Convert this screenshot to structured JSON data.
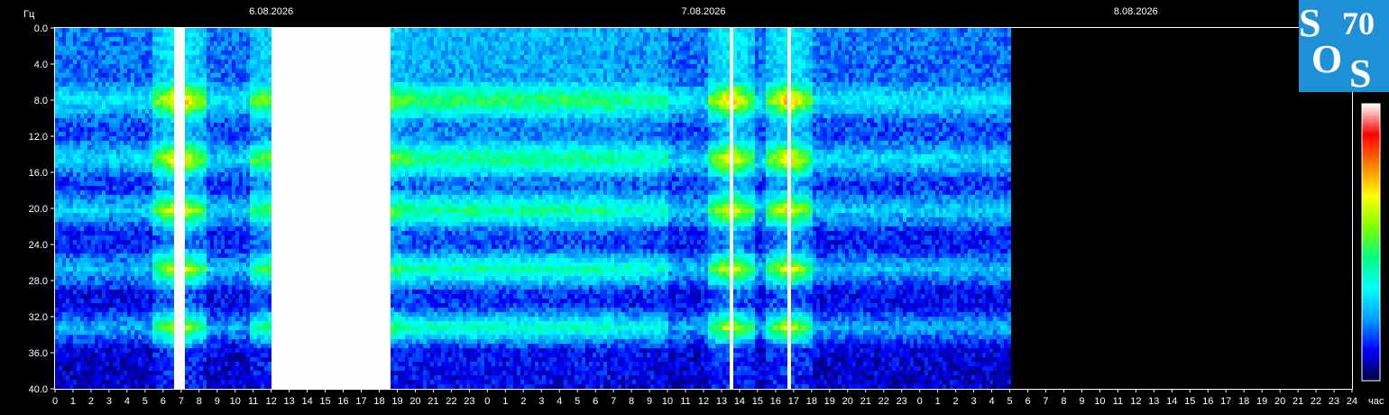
{
  "chart_data": {
    "type": "heatmap",
    "ylabel": "Гц",
    "xlabel": "час",
    "dates": [
      "6.08.2026",
      "7.08.2026",
      "8.08.2026"
    ],
    "yticks": [
      "0.0",
      "4.0",
      "8.0",
      "12.0",
      "16.0",
      "20.0",
      "24.0",
      "28.0",
      "32.0",
      "36.0",
      "40.0"
    ],
    "ylim": [
      0,
      40
    ],
    "xticks": [
      "0",
      "1",
      "2",
      "3",
      "4",
      "5",
      "6",
      "7",
      "8",
      "9",
      "10",
      "11",
      "12",
      "13",
      "14",
      "15",
      "16",
      "17",
      "18",
      "19",
      "20",
      "21",
      "22",
      "23",
      "0",
      "1",
      "2",
      "3",
      "4",
      "5",
      "6",
      "7",
      "8",
      "9",
      "10",
      "11",
      "12",
      "13",
      "14",
      "15",
      "16",
      "17",
      "18",
      "19",
      "20",
      "21",
      "22",
      "23",
      "0",
      "1",
      "2",
      "3",
      "4",
      "5",
      "6",
      "7",
      "8",
      "9",
      "10",
      "11",
      "12",
      "13",
      "14",
      "15",
      "16",
      "17",
      "18",
      "19",
      "20",
      "21",
      "22",
      "23",
      "24"
    ],
    "data_end_hour": 53.0,
    "bands_hz": [
      7.8,
      14.3,
      20.0,
      26.5,
      33.0
    ],
    "intense_periods_hours": [
      [
        6.5,
        7.2
      ],
      [
        12.0,
        18.5
      ],
      [
        37.3,
        37.6
      ],
      [
        40.5,
        40.8
      ]
    ],
    "colorscale": [
      "#000040",
      "#0000ff",
      "#00a0ff",
      "#00ffff",
      "#00ff80",
      "#80ff00",
      "#ffff00",
      "#ff8000",
      "#ff0000",
      "#ffffff"
    ],
    "grid": false,
    "legend": "right"
  },
  "logo": {
    "letters": [
      "S",
      "O",
      "S"
    ],
    "number": "70",
    "color": "#1e90d8"
  }
}
